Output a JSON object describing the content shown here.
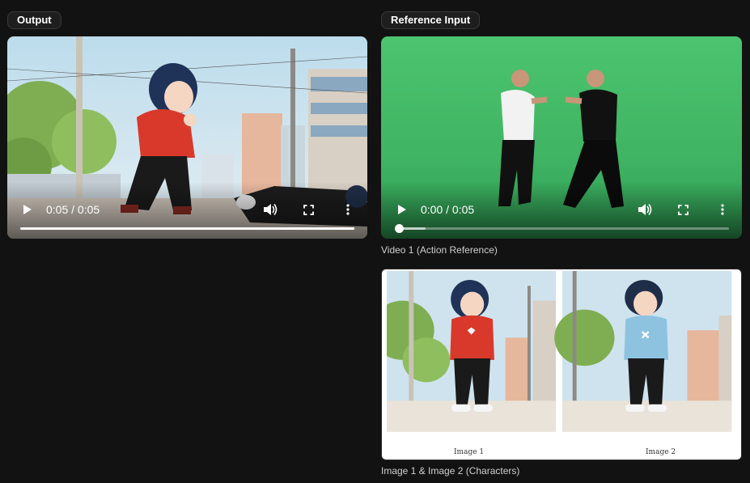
{
  "panels": {
    "output_label": "Output",
    "reference_label": "Reference Input"
  },
  "output_video": {
    "time": "0:05 / 0:05",
    "progress": 1.0
  },
  "reference_video": {
    "time": "0:00 / 0:05",
    "progress": 0.0,
    "buffered": 0.08,
    "caption": "Video 1 (Action Reference)"
  },
  "characters": {
    "image1_label": "Image 1",
    "image2_label": "Image 2",
    "caption": "Image 1 & Image 2 (Characters)"
  },
  "icons": [
    "play-icon",
    "volume-icon",
    "fullscreen-icon",
    "more-vert-icon"
  ],
  "colors": {
    "background": "#121212",
    "green_screen": "#3fb463",
    "red_hoodie": "#d8392b",
    "blue_hoodie": "#8ec3e0"
  }
}
